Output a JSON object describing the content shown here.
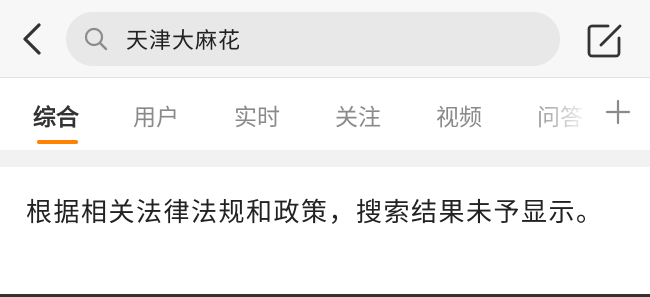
{
  "search": {
    "query": "天津大麻花"
  },
  "icons": {
    "back": "chevron-left-icon",
    "search": "search-icon",
    "compose": "compose-icon",
    "add": "plus-icon"
  },
  "tabs": [
    {
      "label": "综合",
      "active": true
    },
    {
      "label": "用户",
      "active": false
    },
    {
      "label": "实时",
      "active": false
    },
    {
      "label": "关注",
      "active": false
    },
    {
      "label": "视频",
      "active": false
    },
    {
      "label": "问答",
      "active": false
    }
  ],
  "notice": {
    "text": "根据相关法律法规和政策，搜索结果未予显示。"
  },
  "colors": {
    "accent": "#ff8200",
    "tab_inactive": "#8a8a8a",
    "tab_active": "#333333",
    "search_bg": "#e8e8e8"
  }
}
